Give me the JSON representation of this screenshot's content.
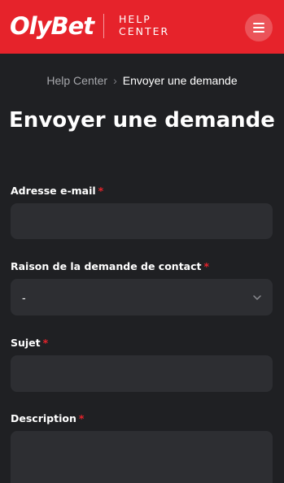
{
  "header": {
    "logo_text": "OlyBet",
    "help_center_text": "HELP CENTER",
    "menu_icon": "hamburger-icon",
    "colors": {
      "header_bg": "#e6232b",
      "page_bg": "#1f2023",
      "field_bg": "#2d2e32",
      "required": "#e6232b"
    }
  },
  "breadcrumb": {
    "home": "Help Center",
    "separator": "›",
    "current": "Envoyer une demande"
  },
  "page_title": "Envoyer une demande",
  "form": {
    "email": {
      "label": "Adresse e-mail",
      "required_mark": "*",
      "value": ""
    },
    "reason": {
      "label": "Raison de la demande de contact",
      "required_mark": "*",
      "selected": "-"
    },
    "subject": {
      "label": "Sujet",
      "required_mark": "*",
      "value": ""
    },
    "description": {
      "label": "Description",
      "required_mark": "*",
      "value": ""
    }
  }
}
